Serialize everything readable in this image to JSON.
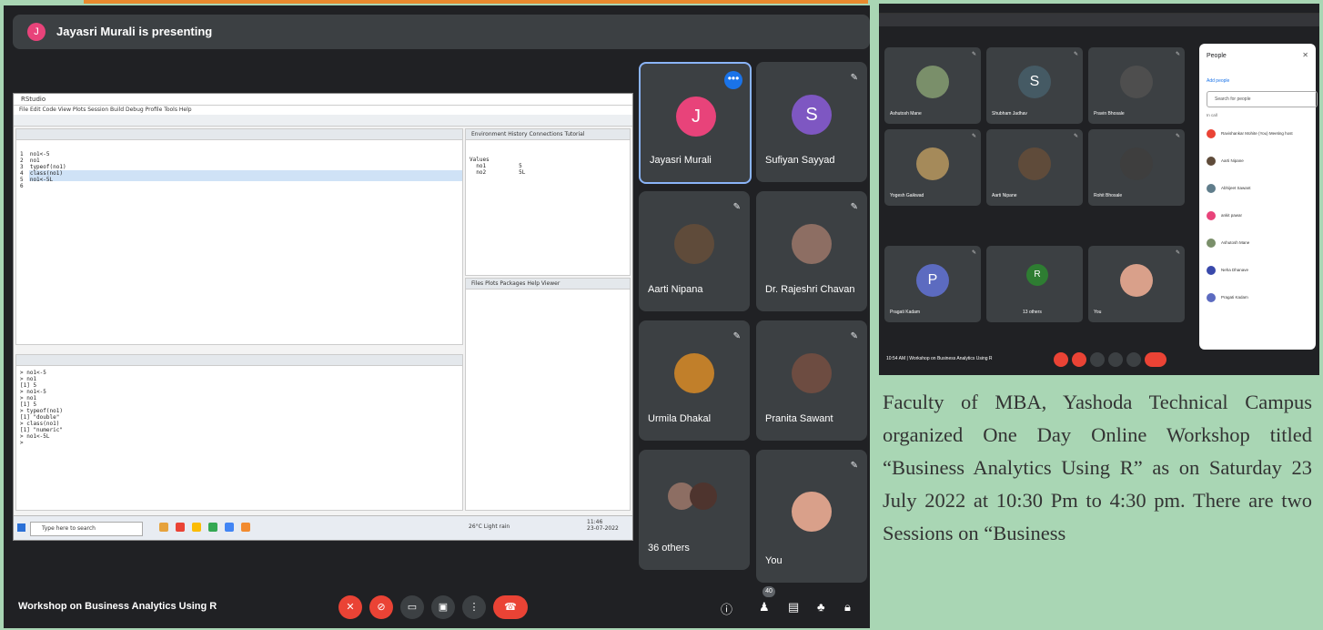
{
  "presenting": {
    "avatar_letter": "J",
    "text": "Jayasri Murali is presenting"
  },
  "rstudio": {
    "title": "RStudio",
    "menu": "File  Edit  Code  View  Plots  Session  Build  Debug  Profile  Tools  Help",
    "code": "1  no1<-5\n2  no1\n3  typeof(no1)\n4  class(no1)\n5  no1<-5L\n6",
    "console": "> no1<-5\n> no1\n[1] 5\n> no1<-5\n> no1\n[1] 5\n> typeof(no1)\n[1] \"double\"\n> class(no1)\n[1] \"numeric\"\n> no1<-5L\n>",
    "env_tabs": "Environment  History  Connections  Tutorial",
    "env_values": "Values\n  no1          5\n  no2          5L",
    "files_tabs": "Files  Plots  Packages  Help  Viewer",
    "search_placeholder": "Type here to search",
    "weather": "26°C  Light rain",
    "clock": "11:46\n23-07-2022"
  },
  "tiles": [
    {
      "name": "Jayasri Murali",
      "letter": "J",
      "color": "#e8437a"
    },
    {
      "name": "Sufiyan Sayyad",
      "letter": "S",
      "color": "#7e57c2"
    },
    {
      "name": "Aarti Nipana",
      "letter": "",
      "color": "#5f4b3a"
    },
    {
      "name": "Dr. Rajeshri Chavan",
      "letter": "",
      "color": "#8d6e63"
    },
    {
      "name": "Urmila Dhakal",
      "letter": "",
      "color": "#c17f2a"
    },
    {
      "name": "Pranita Sawant",
      "letter": "",
      "color": "#6d4c41"
    },
    {
      "name": "36 others",
      "letter": "",
      "color": "#8d6e63"
    },
    {
      "name": "You",
      "letter": "",
      "color": "#d9a08a"
    }
  ],
  "bottom_bar": {
    "meeting_name": "Workshop on Business Analytics Using R",
    "people_count": "40"
  },
  "shot2": {
    "tiles": [
      {
        "name": "Ashutosh Mane",
        "letter": "",
        "color": "#7a8f6a"
      },
      {
        "name": "Shubham Jadhav",
        "letter": "S",
        "color": "#455a64"
      },
      {
        "name": "Pravin Bhosale",
        "letter": "",
        "color": "#4e4e4e"
      },
      {
        "name": "Yogesh Gaikwad",
        "letter": "",
        "color": "#a58a5a"
      },
      {
        "name": "Aarti Nipane",
        "letter": "",
        "color": "#5f4b3a"
      },
      {
        "name": "Rohit Bhosale",
        "letter": "",
        "color": "#3e3e3e"
      },
      {
        "name": "Pragati Kadam",
        "letter": "P",
        "color": "#5c6bc0"
      },
      {
        "name": "13 others",
        "letter": "R",
        "color": "#2e7d32"
      },
      {
        "name": "You",
        "letter": "",
        "color": "#d9a08a"
      }
    ],
    "people_title": "People",
    "add_people": "Add people",
    "search_people": "Search for people",
    "in_call_label": "In call",
    "participants": [
      {
        "name": "Ravishankar Mohite (You) Meeting host",
        "color": "#ea4335"
      },
      {
        "name": "Aarti Nipane",
        "color": "#5f4b3a"
      },
      {
        "name": "Abhijeet Sawant",
        "color": "#607d8b"
      },
      {
        "name": "ankit pawar",
        "color": "#e8437a"
      },
      {
        "name": "Ashutosh Mane",
        "color": "#7a8f6a"
      },
      {
        "name": "Neha Dhanave",
        "color": "#3949ab"
      },
      {
        "name": "Pragati Kadam",
        "color": "#5c6bc0"
      }
    ],
    "time_meeting": "10:54 AM  |  Workshop on Business Analytics Using R"
  },
  "description": "Faculty of MBA, Yashoda Technical Campus organized One Day Online Workshop titled “Business Analytics Using R” as on Saturday 23 July 2022 at 10:30 Pm to 4:30 pm. There are two Sessions on “Business"
}
